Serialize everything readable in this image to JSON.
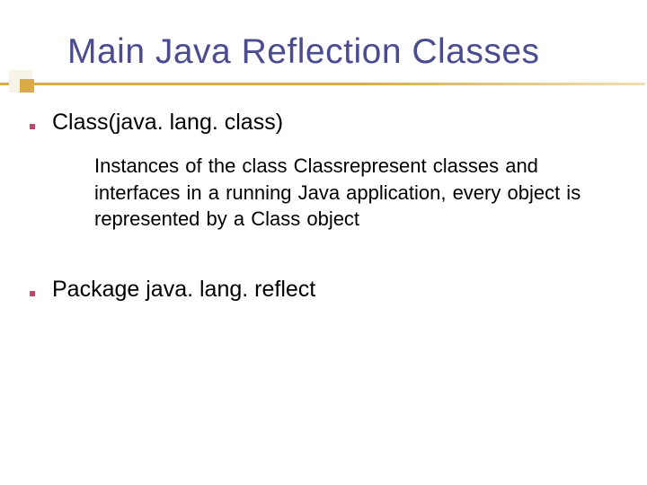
{
  "title": "Main Java Reflection Classes",
  "section1": {
    "heading": "Class(java. lang. class)",
    "body": "Instances of the class Classrepresent classes and interfaces in a running  Java application, every object is  represented  by a Class object"
  },
  "section2": {
    "heading": "Package java. lang. reflect"
  }
}
